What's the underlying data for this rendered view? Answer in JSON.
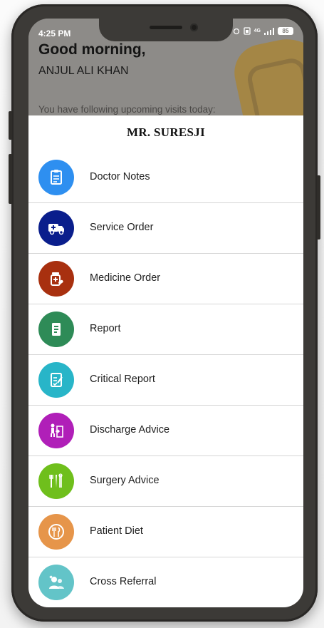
{
  "status_bar": {
    "time": "4:25 PM",
    "signal": "4G",
    "battery": "85"
  },
  "background_app": {
    "greeting": "Good morning,",
    "user_name": "ANJUL ALI KHAN",
    "visits_text": "You have following upcoming visits today:"
  },
  "sheet": {
    "title": "MR. SURESJI",
    "items": [
      {
        "label": "Doctor Notes",
        "icon": "clipboard-icon",
        "color": "#2e8ff0"
      },
      {
        "label": "Service Order",
        "icon": "ambulance-icon",
        "color": "#0a1e8c"
      },
      {
        "label": "Medicine Order",
        "icon": "medicine-icon",
        "color": "#a8300f"
      },
      {
        "label": "Report",
        "icon": "report-icon",
        "color": "#2e8b57"
      },
      {
        "label": "Critical Report",
        "icon": "critical-report-icon",
        "color": "#28b5c8"
      },
      {
        "label": "Discharge Advice",
        "icon": "discharge-icon",
        "color": "#b01fb8"
      },
      {
        "label": "Surgery Advice",
        "icon": "surgery-tools-icon",
        "color": "#6fbf1c"
      },
      {
        "label": "Patient Diet",
        "icon": "diet-icon",
        "color": "#e6954a"
      },
      {
        "label": "Cross Referral",
        "icon": "cross-referral-icon",
        "color": "#63c4c8"
      }
    ]
  }
}
